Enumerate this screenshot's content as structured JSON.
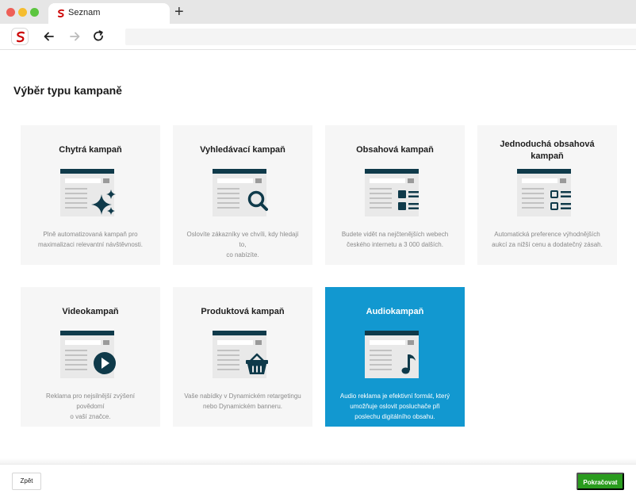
{
  "browser": {
    "tab_title": "Seznam",
    "new_tab_symbol": "+",
    "icons": [
      "seznam-favicon",
      "back-arrow-icon",
      "forward-arrow-icon",
      "reload-icon",
      "seznam-logo-icon"
    ]
  },
  "page": {
    "title": "Výběr typu kampaně"
  },
  "campaigns": [
    {
      "title": "Chytrá kampaň",
      "icon": "sparkle-icon",
      "desc_lines": [
        "Plně automatizovaná kampaň pro",
        "maximalizaci relevantní návštěvnosti."
      ]
    },
    {
      "title": "Vyhledávací kampaň",
      "icon": "magnifier-icon",
      "desc_lines": [
        "Oslovíte zákazníky ve chvíli, kdy hledají to,",
        "co nabízíte."
      ]
    },
    {
      "title": "Obsahová kampaň",
      "icon": "content-list-icon",
      "desc_lines": [
        "Budete vidět na nejčtenějších webech",
        "českého internetu a 3 000 dalších."
      ]
    },
    {
      "title_lines": [
        "Jednoduchá obsahová",
        "kampaň"
      ],
      "icon": "checkbox-list-icon",
      "desc_lines": [
        "Automatická preference výhodnějších",
        "aukcí za nižší cenu a dodatečný zásah."
      ]
    },
    {
      "title": "Videokampaň",
      "icon": "play-icon",
      "desc_lines": [
        "Reklama pro nejsilnější zvýšení povědomí",
        "o vaší značce."
      ]
    },
    {
      "title": "Produktová kampaň",
      "icon": "shopping-basket-icon",
      "desc_lines": [
        "Vaše nabídky v Dynamickém retargetingu",
        "nebo Dynamickém banneru."
      ]
    },
    {
      "title": "Audiokampaň",
      "icon": "music-note-icon",
      "selected": true,
      "desc_lines": [
        "Audio reklama je efektivní formát, který",
        "umožňuje oslovit posluchače při",
        "poslechu digitálního obsahu."
      ]
    }
  ],
  "footer": {
    "back_label": "Zpět",
    "next_label": "Pokračovat"
  },
  "colors": {
    "selected_card": "#1298d0",
    "primary_button": "#2a9c1e",
    "illustration_dark": "#0f3a4a",
    "card_bg": "#f6f6f6"
  }
}
